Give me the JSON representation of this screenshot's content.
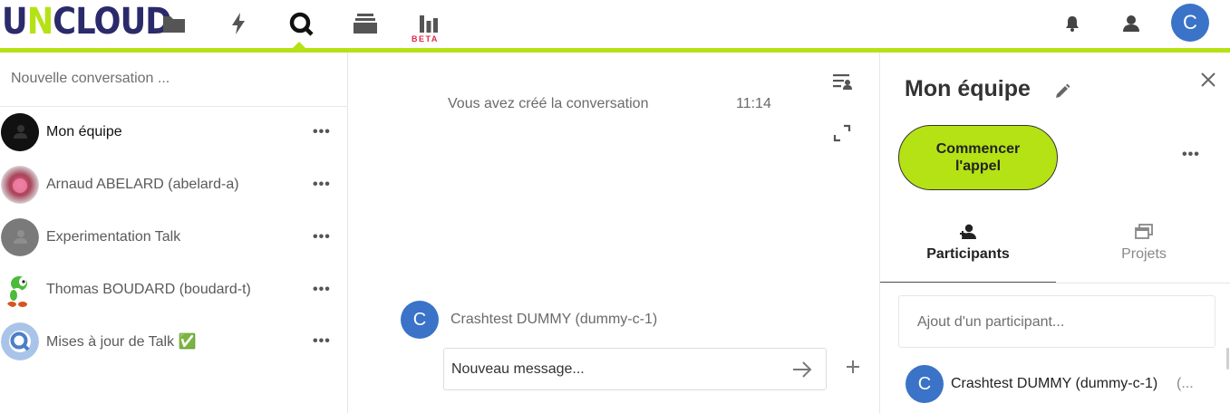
{
  "header": {
    "logo_prefix": "U",
    "logo_accent": "N",
    "logo_suffix": "CLOUD",
    "apps": [
      {
        "icon": "folder-icon"
      },
      {
        "icon": "activity-icon"
      },
      {
        "icon": "talk-icon",
        "active": true
      },
      {
        "icon": "deck-icon"
      },
      {
        "icon": "analytics-icon"
      }
    ],
    "beta_label": "BETA",
    "user_initial": "C"
  },
  "colors": {
    "brand_navy": "#2b2a6b",
    "accent_green": "#b5e215",
    "avatar_blue": "#3a73c8",
    "beta_red": "#e0294a"
  },
  "sidebar": {
    "search_placeholder": "Nouvelle conversation ...",
    "conversations": [
      {
        "name": "Mon équipe",
        "avatar": "group-avatar",
        "active": true,
        "more": "•••"
      },
      {
        "name": "Arnaud ABELARD (abelard-a)",
        "avatar": "photo-avatar",
        "more": "•••"
      },
      {
        "name": "Experimentation Talk",
        "avatar": "group-avatar",
        "more": "•••"
      },
      {
        "name": "Thomas BOUDARD (boudard-t)",
        "avatar": "yoshi-avatar",
        "more": "•••"
      },
      {
        "name": "Mises à jour de Talk ✅",
        "avatar": "talk-avatar",
        "more": "•••"
      }
    ]
  },
  "chat": {
    "system_message": "Vous avez créé la conversation",
    "system_time": "11:14",
    "composer_initial": "C",
    "composer_name": "Crashtest DUMMY (dummy-c-1)",
    "message_placeholder": "Nouveau message..."
  },
  "panel": {
    "title": "Mon équipe",
    "call_button": "Commencer l'appel",
    "more": "•••",
    "tabs": [
      {
        "label": "Participants",
        "icon": "participants-icon",
        "active": true
      },
      {
        "label": "Projets",
        "icon": "projects-icon",
        "active": false
      }
    ],
    "add_participant_placeholder": "Ajout d'un participant...",
    "participants": [
      {
        "initial": "C",
        "name": "Crashtest DUMMY (dummy-c-1)",
        "extra": "(..."
      }
    ]
  }
}
